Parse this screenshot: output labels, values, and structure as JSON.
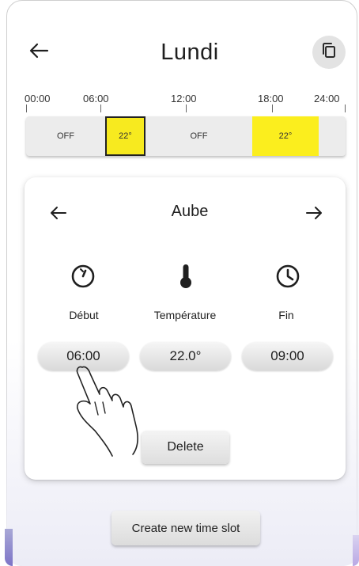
{
  "header": {
    "title": "Lundi",
    "back_icon": "arrow-left-icon",
    "copy_icon": "copy-icon"
  },
  "timeline": {
    "ticks": [
      "00:00",
      "06:00",
      "12:00",
      "18:00",
      "24:00"
    ],
    "segments": [
      {
        "label": "OFF",
        "state": "off",
        "selected": false
      },
      {
        "label": "22°",
        "state": "on",
        "selected": true
      },
      {
        "label": "OFF",
        "state": "off",
        "selected": false
      },
      {
        "label": "22°",
        "state": "on",
        "selected": false
      },
      {
        "label": "",
        "state": "off",
        "selected": false
      }
    ],
    "colors": {
      "active": "#fbee1e",
      "track": "#ececec"
    }
  },
  "card": {
    "title": "Aube",
    "prev_icon": "arrow-left-icon",
    "next_icon": "arrow-right-icon",
    "columns": [
      {
        "icon": "start-timer-icon",
        "label": "Début",
        "value": "06:00"
      },
      {
        "icon": "thermometer-icon",
        "label": "Température",
        "value": "22.0°"
      },
      {
        "icon": "clock-icon",
        "label": "Fin",
        "value": "09:00"
      }
    ],
    "delete_label": "Delete"
  },
  "footer": {
    "create_label": "Create new time slot"
  },
  "overlay": {
    "gesture_icon": "tap-hand-icon"
  }
}
